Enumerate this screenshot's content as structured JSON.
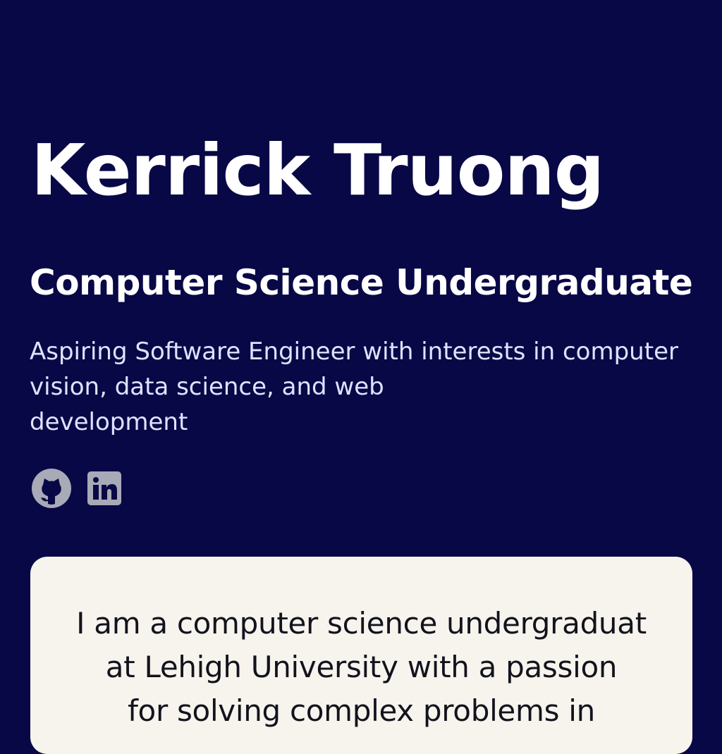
{
  "profile": {
    "name": "Kerrick Truong",
    "title": "Computer Science Undergraduate",
    "tagline_lines": [
      "Aspiring Software Engineer with interests in computer",
      "vision, data science, and web",
      "development"
    ]
  },
  "socials": [
    {
      "icon": "github-icon"
    },
    {
      "icon": "linkedin-icon"
    }
  ],
  "about": {
    "lines": [
      "I am a computer science undergraduat",
      "at Lehigh University with a passion",
      "for solving complex problems in"
    ]
  },
  "colors": {
    "background": "#090846",
    "heading": "#ffffff",
    "social_icon": "#a9aab7",
    "card": "#f7f4ee",
    "card_text": "#13131d"
  }
}
